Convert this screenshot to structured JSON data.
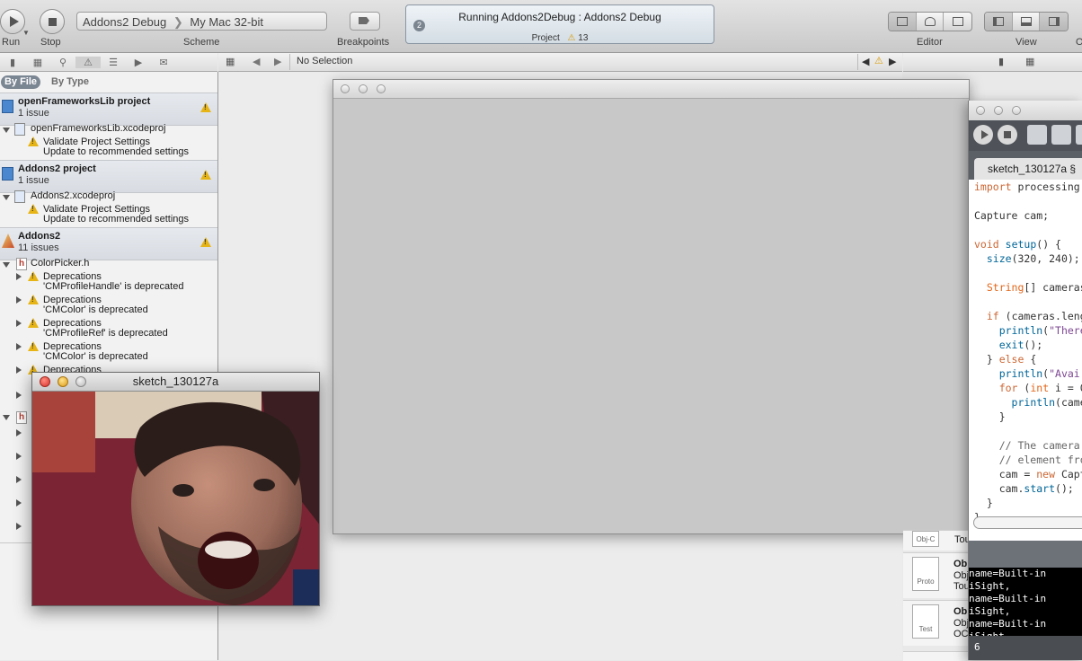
{
  "toolbar": {
    "run_label": "Run",
    "stop_label": "Stop",
    "scheme_label": "Scheme",
    "scheme_target": "Addons2 Debug",
    "scheme_destination": "My Mac 32-bit",
    "breakpoints_label": "Breakpoints",
    "activity_count": "2",
    "activity_title": "Running Addons2Debug : Addons2 Debug",
    "activity_project": "Project",
    "activity_warnings": "13",
    "editor_label": "Editor",
    "view_label": "View",
    "organizer_label": "O"
  },
  "jumpbar": {
    "selection": "No Selection"
  },
  "navigator": {
    "scope_by_file": "By File",
    "scope_by_type": "By Type",
    "groups": [
      {
        "name": "openFrameworksLib project",
        "count": "1 issue",
        "file": "openFrameworksLib.xcodeproj",
        "issue_title": "Validate Project Settings",
        "issue_detail": "Update to recommended settings"
      },
      {
        "name": "Addons2 project",
        "count": "1 issue",
        "file": "Addons2.xcodeproj",
        "issue_title": "Validate Project Settings",
        "issue_detail": "Update to recommended settings"
      },
      {
        "name": "Addons2",
        "count": "11 issues",
        "file": "ColorPicker.h"
      }
    ],
    "issues": [
      {
        "title": "Deprecations",
        "detail": "'CMProfileHandle' is deprecated"
      },
      {
        "title": "Deprecations",
        "detail": "'CMColor' is deprecated"
      },
      {
        "title": "Deprecations",
        "detail": "'CMProfileRef' is deprecated"
      },
      {
        "title": "Deprecations",
        "detail": "'CMColor' is deprecated"
      },
      {
        "title": "Deprecations",
        "detail": ""
      }
    ]
  },
  "sketch": {
    "title": "sketch_130127a"
  },
  "processing": {
    "tab": "sketch_130127a §",
    "code_lines": [
      "import processing",
      "",
      "Capture cam;",
      "",
      "void setup() {",
      "  size(320, 240);",
      "",
      "  String[] cameras",
      "",
      "  if (cameras.leng",
      "    println(\"There",
      "    exit();",
      "  } else {",
      "    println(\"Avai",
      "    for (int i = 0",
      "      println(came",
      "    }",
      "",
      "    // The camera",
      "    // element fro",
      "    cam = new Capt",
      "    cam.start();",
      "  }",
      "}"
    ],
    "console_lines": [
      "name=Built-in iSight,",
      "name=Built-in iSight,",
      "name=Built-in iSight,"
    ],
    "line_number": "6"
  },
  "library": {
    "items": [
      {
        "badge": "Obj-C",
        "title": "Tou"
      },
      {
        "badge": "Proto",
        "title": "Ob",
        "line2": "Obj",
        "line3": "Tou"
      },
      {
        "badge": "Test",
        "title": "Ob",
        "line2": "Obj",
        "line3": "OC"
      }
    ]
  }
}
